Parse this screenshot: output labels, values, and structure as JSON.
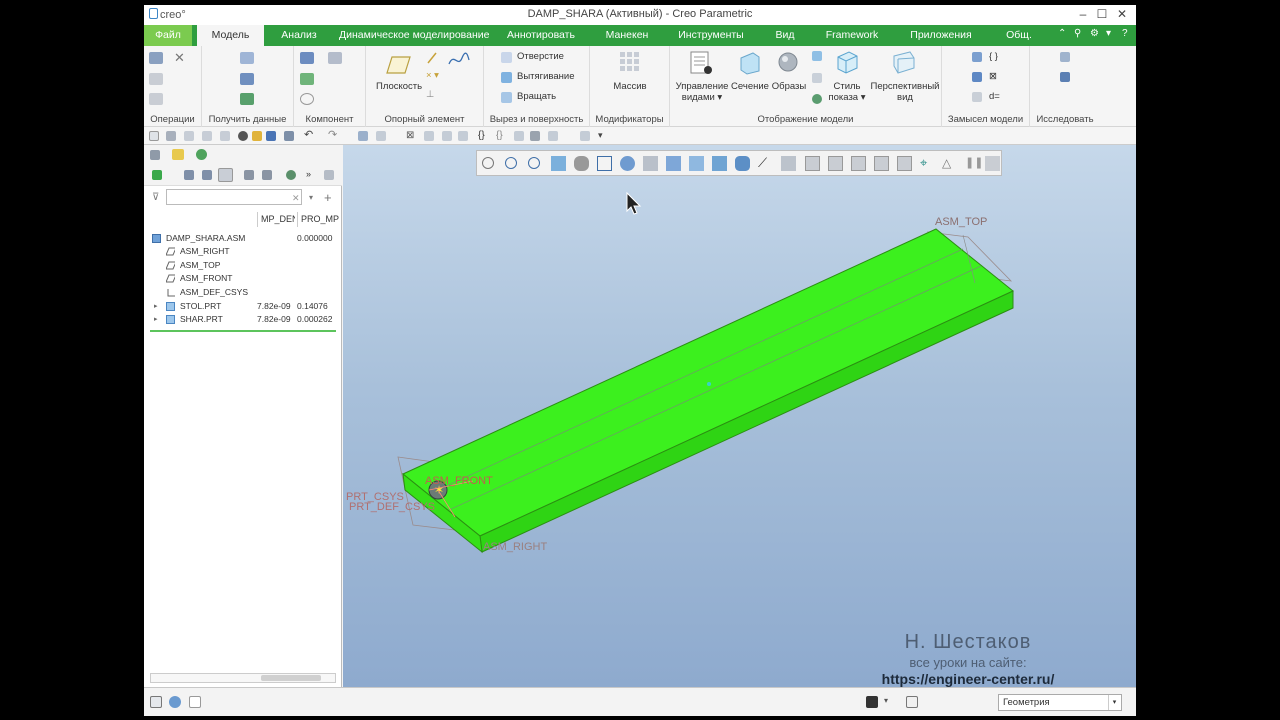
{
  "window": {
    "logo": "creo°",
    "title": "DAMP_SHARA (Активный) - Creo Parametric",
    "minimize": "–",
    "maximize": "☐",
    "close": "✕"
  },
  "tabs": [
    {
      "label": "Файл",
      "key": "file"
    },
    {
      "label": "Модель",
      "key": "model"
    },
    {
      "label": "Анализ",
      "key": "analysis"
    },
    {
      "label": "Динамическое моделирование",
      "key": "dynamic"
    },
    {
      "label": "Аннотировать",
      "key": "annotate"
    },
    {
      "label": "Манекен",
      "key": "manikin"
    },
    {
      "label": "Инструменты",
      "key": "tools"
    },
    {
      "label": "Вид",
      "key": "view"
    },
    {
      "label": "Framework",
      "key": "framework"
    },
    {
      "label": "Приложения",
      "key": "apps"
    },
    {
      "label": "Общ.",
      "key": "common"
    }
  ],
  "active_tab": "Модель",
  "ribbon": {
    "groups": {
      "operations": "Операции",
      "get_data": "Получить данные",
      "component": "Компонент",
      "datum": "Опорный элемент",
      "cut_surface": "Вырез и поверхность",
      "modifiers": "Модификаторы",
      "model_display": "Отображение модели",
      "model_intent": "Замысел модели",
      "investigate": "Исследовать"
    },
    "buttons": {
      "plane": "Плоскость",
      "hole": "Отверстие",
      "extrude": "Вытягивание",
      "revolve": "Вращать",
      "mass": "Массив",
      "manage_views_1": "Управление",
      "manage_views_2": "видами",
      "section": "Сечение",
      "appearances": "Образы",
      "display_style_1": "Стиль",
      "display_style_2": "показа",
      "perspective_1": "Перспективный",
      "perspective_2": "вид"
    }
  },
  "model_tree": {
    "filter_placeholder": "",
    "columns": [
      "MP_DEN",
      "PRO_MP"
    ],
    "rows": [
      {
        "name": "DAMP_SHARA.ASM",
        "c1": "",
        "c2": "0.000000",
        "type": "asm"
      },
      {
        "name": "ASM_RIGHT",
        "c1": "",
        "c2": "",
        "type": "plane"
      },
      {
        "name": "ASM_TOP",
        "c1": "",
        "c2": "",
        "type": "plane"
      },
      {
        "name": "ASM_FRONT",
        "c1": "",
        "c2": "",
        "type": "plane"
      },
      {
        "name": "ASM_DEF_CSYS",
        "c1": "",
        "c2": "",
        "type": "csys"
      },
      {
        "name": "STOL.PRT",
        "c1": "7.82e-09",
        "c2": "0.14076",
        "type": "part"
      },
      {
        "name": "SHAR.PRT",
        "c1": "7.82e-09",
        "c2": "0.000262",
        "type": "part"
      }
    ]
  },
  "viewport": {
    "labels": {
      "asm_top": "ASM_TOP",
      "asm_front": "ASM_FRONT",
      "asm_right": "ASM_RIGHT",
      "prt_csys": "PRT_CSYS",
      "prt_def_csys": "PRT_DEF_CSYS"
    },
    "part_color": "#3cf01e"
  },
  "watermark": {
    "author": "Н. Шестаков",
    "line2": "все уроки на сайте:",
    "url": "https://engineer-center.ru/"
  },
  "status": {
    "filter_value": "Геометрия"
  }
}
